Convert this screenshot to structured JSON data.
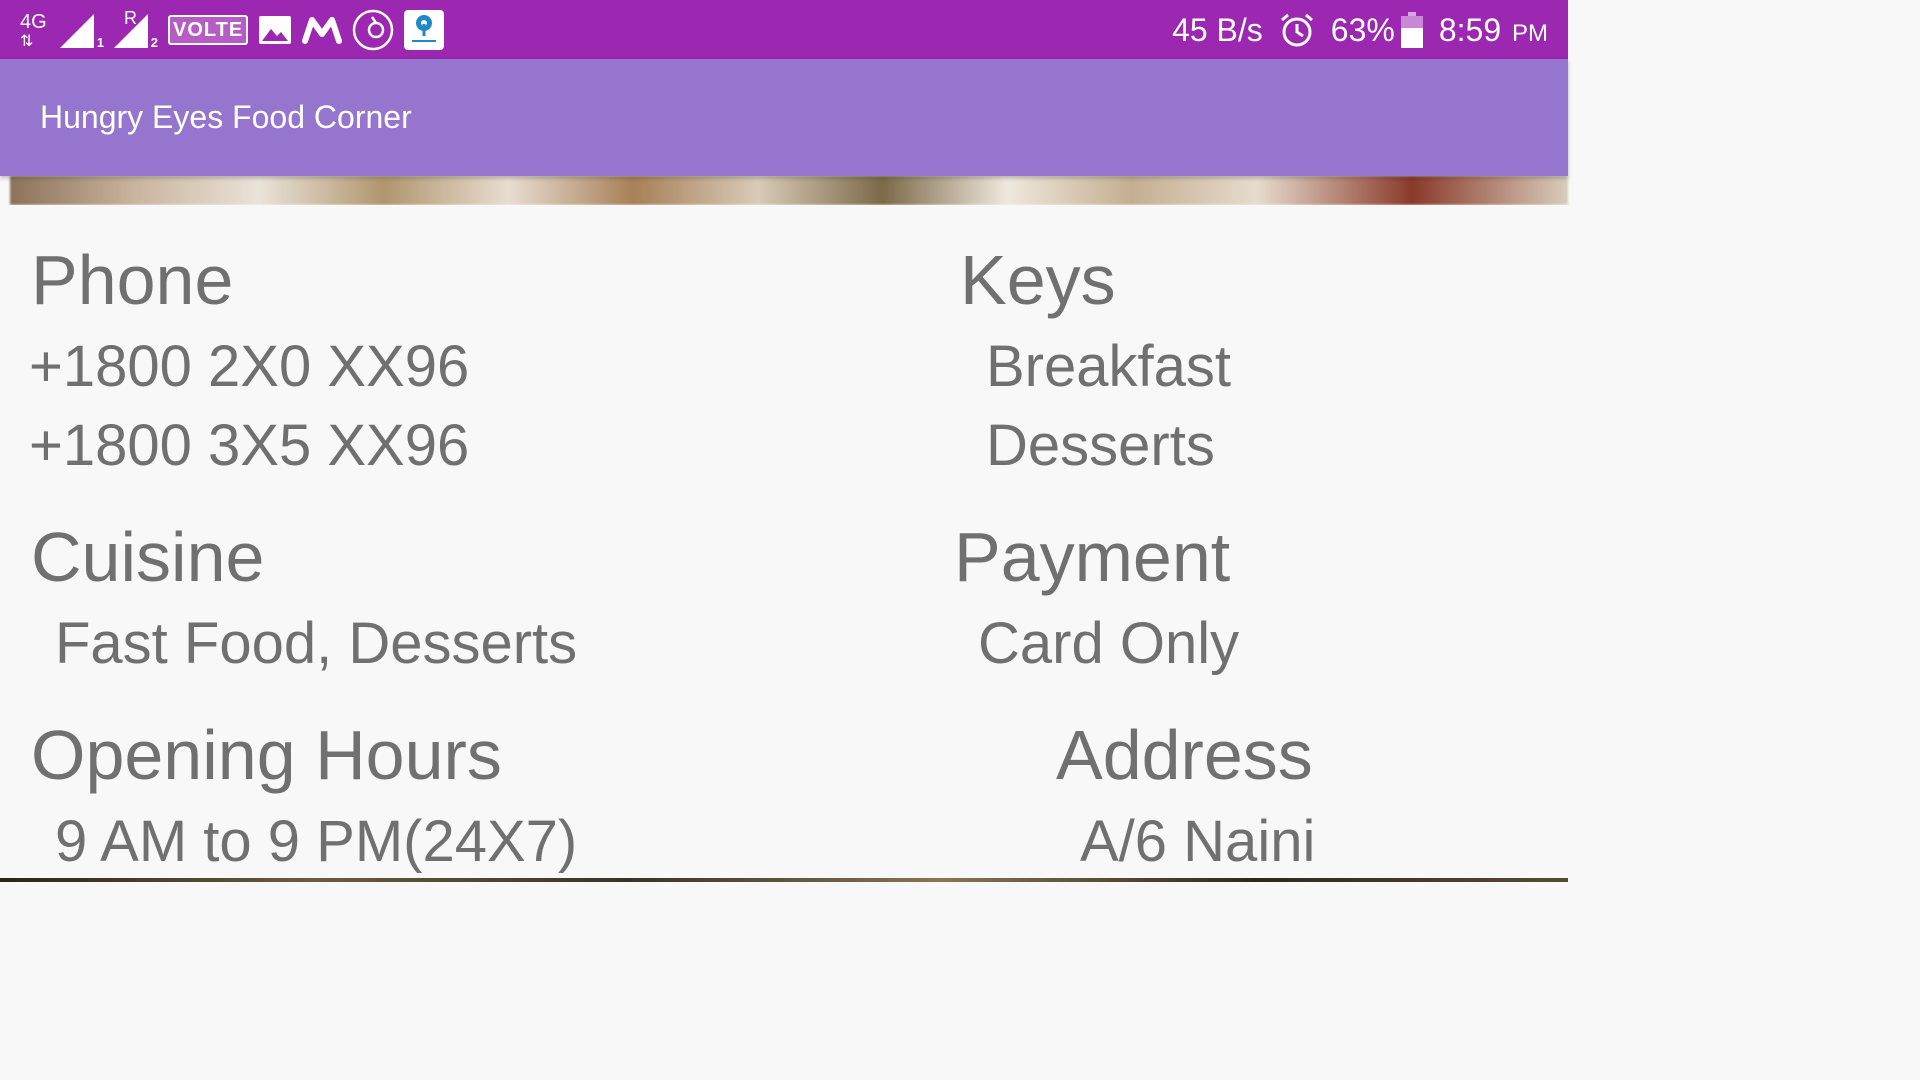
{
  "status_bar": {
    "network_type": "4G",
    "sim1_label": "1",
    "sim2_roaming": "R",
    "sim2_label": "2",
    "volte": "VOLTE",
    "net_speed": "45 B/s",
    "battery_percent": "63%",
    "battery_level": 0.63,
    "time": "8:59",
    "ampm": "PM",
    "icons": [
      "signal-icon",
      "signal-roaming-icon",
      "volte-badge",
      "gallery-icon",
      "myntra-icon",
      "music-icon",
      "app-notification-icon",
      "alarm-icon",
      "battery-icon"
    ]
  },
  "app_bar": {
    "title": "Hungry Eyes Food Corner"
  },
  "details": {
    "phone": {
      "heading": "Phone",
      "values": [
        "+1800 2X0 XX96",
        "+1800 3X5 XX96"
      ]
    },
    "keys": {
      "heading": "Keys",
      "values": [
        "Breakfast",
        "Desserts"
      ]
    },
    "cuisine": {
      "heading": "Cuisine",
      "value": "Fast Food, Desserts"
    },
    "payment": {
      "heading": "Payment",
      "value": "Card Only"
    },
    "opening_hours": {
      "heading": "Opening Hours",
      "value": "9 AM to 9 PM(24X7)"
    },
    "address": {
      "heading": "Address",
      "value": "A/6 Naini"
    }
  },
  "colors": {
    "status_bar": "#9c27b0",
    "app_bar": "#9575cd",
    "text": "#707070",
    "background": "#f8f8f8"
  }
}
